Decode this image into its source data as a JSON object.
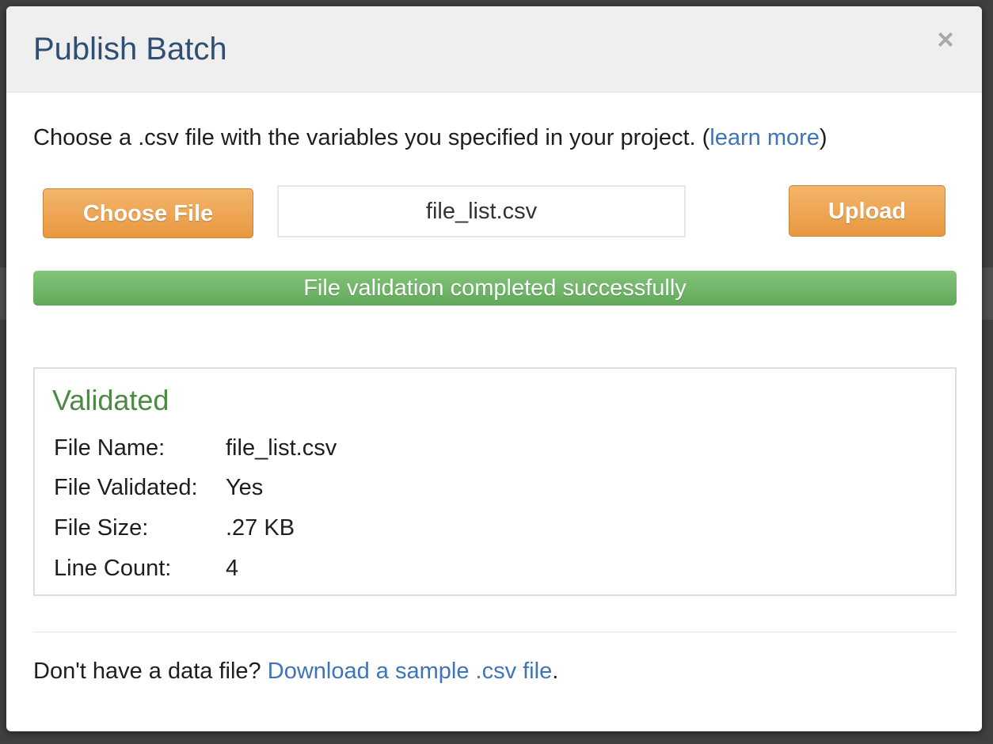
{
  "dialog": {
    "title": "Publish Batch",
    "close_label": "×"
  },
  "intro": {
    "text": "Choose a .csv file with the variables you specified in your project. (",
    "link": "learn more",
    "suffix": ")"
  },
  "upload": {
    "choose_label": "Choose File",
    "file_name": "file_list.csv",
    "upload_label": "Upload"
  },
  "progress": {
    "percent": 100,
    "text": "File validation completed successfully",
    "color": "#6db365"
  },
  "validation": {
    "title": "Validated",
    "rows": [
      {
        "label": "File Name:",
        "value": "file_list.csv"
      },
      {
        "label": "File Validated:",
        "value": "Yes"
      },
      {
        "label": "File Size:",
        "value": ".27 KB"
      },
      {
        "label": "Line Count:",
        "value": "4"
      }
    ]
  },
  "footer": {
    "text": "Don't have a data file? ",
    "link": "Download a sample .csv file",
    "suffix": "."
  }
}
